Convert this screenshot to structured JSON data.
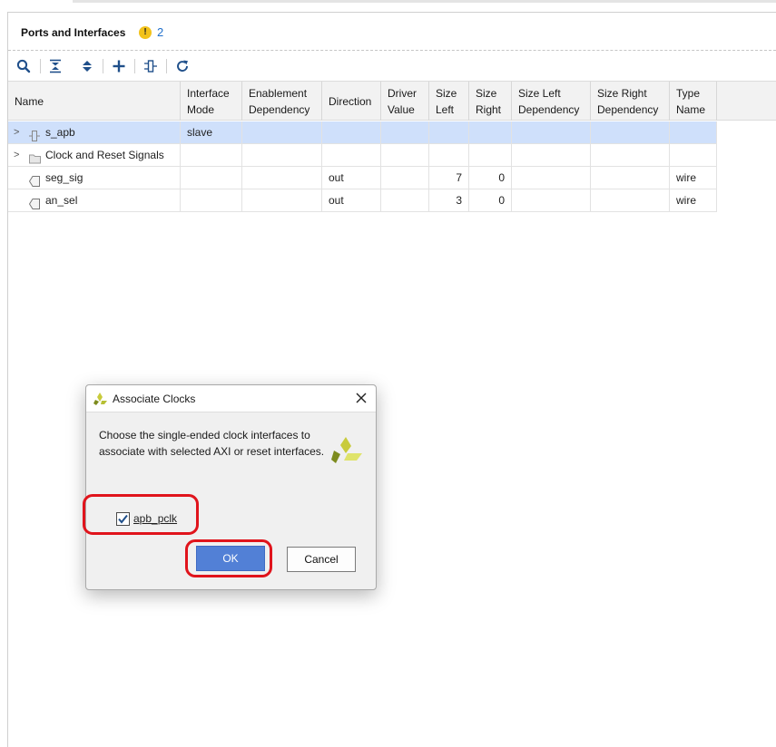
{
  "panel": {
    "title": "Ports and Interfaces",
    "warning_count": "2",
    "warning_glyph": "!"
  },
  "toolbar": {
    "icons": [
      "search-icon",
      "collapse-all-icon",
      "expand-all-icon",
      "add-icon",
      "map-ports-icon",
      "refresh-icon"
    ]
  },
  "table": {
    "columns": [
      {
        "l1": "Name",
        "l2": ""
      },
      {
        "l1": "Interface",
        "l2": "Mode"
      },
      {
        "l1": "Enablement",
        "l2": "Dependency"
      },
      {
        "l1": "Direction",
        "l2": ""
      },
      {
        "l1": "Driver",
        "l2": "Value"
      },
      {
        "l1": "Size",
        "l2": "Left"
      },
      {
        "l1": "Size",
        "l2": "Right"
      },
      {
        "l1": "Size Left",
        "l2": "Dependency"
      },
      {
        "l1": "Size Right",
        "l2": "Dependency"
      },
      {
        "l1": "Type",
        "l2": "Name"
      }
    ],
    "rows": [
      {
        "name": "s_apb",
        "interface_mode": "slave",
        "enablement": "",
        "direction": "",
        "driver_value": "",
        "size_left": "",
        "size_right": "",
        "size_left_dep": "",
        "size_right_dep": "",
        "type_name": "",
        "kind": "interface",
        "expandable": true,
        "selected": true
      },
      {
        "name": "Clock and Reset Signals",
        "interface_mode": "",
        "enablement": "",
        "direction": "",
        "driver_value": "",
        "size_left": "",
        "size_right": "",
        "size_left_dep": "",
        "size_right_dep": "",
        "type_name": "",
        "kind": "folder",
        "expandable": true,
        "selected": false
      },
      {
        "name": "seg_sig",
        "interface_mode": "",
        "enablement": "",
        "direction": "out",
        "driver_value": "",
        "size_left": "7",
        "size_right": "0",
        "size_left_dep": "",
        "size_right_dep": "",
        "type_name": "wire",
        "kind": "port",
        "expandable": false,
        "selected": false
      },
      {
        "name": "an_sel",
        "interface_mode": "",
        "enablement": "",
        "direction": "out",
        "driver_value": "",
        "size_left": "3",
        "size_right": "0",
        "size_left_dep": "",
        "size_right_dep": "",
        "type_name": "wire",
        "kind": "port",
        "expandable": false,
        "selected": false
      }
    ]
  },
  "dialog": {
    "title": "Associate Clocks",
    "message": "Choose the single-ended clock interfaces to associate with selected AXI or reset interfaces.",
    "checkbox_label": "apb_pclk",
    "checkbox_checked": true,
    "ok_label": "OK",
    "cancel_label": "Cancel"
  },
  "colors": {
    "selected_row": "#cfe0fb",
    "ok_button": "#5280d6",
    "highlight": "#e0141c",
    "warning": "#f2c21a",
    "warning_count": "#1e6ecb"
  }
}
